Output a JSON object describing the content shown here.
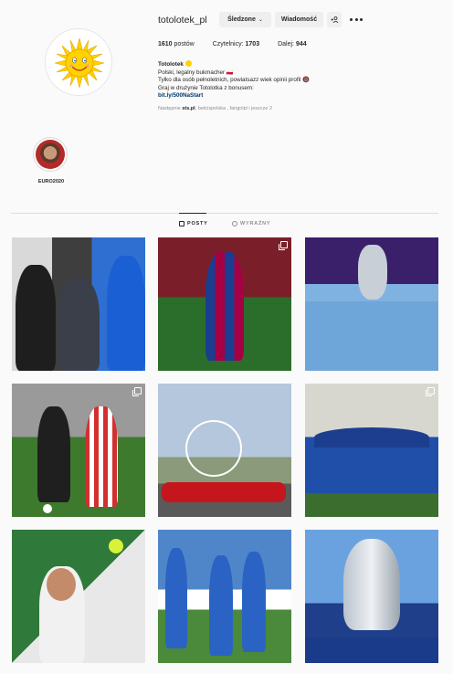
{
  "profile": {
    "username": "totolotek_pl",
    "following_button": "Śledzone",
    "message_button": "Wiadomość",
    "suggest_button": "+Ꮢ",
    "stats": {
      "posts_count": "1610",
      "posts_label": "postów",
      "followers_label": "Czytelnicy:",
      "followers_count": "1703",
      "following_label": "Dalej:",
      "following_count": "944"
    },
    "bio": {
      "name": "Totolotek",
      "line1": "Polski, legalny bukmacher 🇵🇱",
      "line2": "Tylko dla osób pełnoletnich, powiatsazz wiek opinii profil 🔞",
      "line3": "Graj w drużynie Totolotka z bonusem:",
      "link": "bit.ly/500NaStart"
    },
    "followed_by_prefix": "Następnie",
    "followed_by_users": "sts.pl",
    "followed_by_rest": ", betcispolska , fangolpl i jeszcze 2"
  },
  "highlights": [
    {
      "label": "EURO2020"
    }
  ],
  "tabs": {
    "posts": "POSTY",
    "tagged": "WYRAŹNY"
  },
  "colors": {
    "background": "#fafafa",
    "text": "#262626",
    "muted": "#8e8e8e",
    "link": "#00376b",
    "button_bg": "#efefef",
    "divider": "#dbdbdb"
  },
  "posts": [
    {
      "subject": "boxers-faceoff",
      "multi": false
    },
    {
      "subject": "barcelona-player-celebrating",
      "multi": true
    },
    {
      "subject": "manchester-city-trophy",
      "multi": false
    },
    {
      "subject": "cracovia-vs-legia-match",
      "multi": true
    },
    {
      "subject": "f1-car-ferris-wheel",
      "multi": false
    },
    {
      "subject": "lech-poznan-champions",
      "multi": true
    },
    {
      "subject": "tennis-player-serve",
      "multi": false
    },
    {
      "subject": "football-team-celebration",
      "multi": false
    },
    {
      "subject": "champions-league-trophy",
      "multi": false
    }
  ]
}
